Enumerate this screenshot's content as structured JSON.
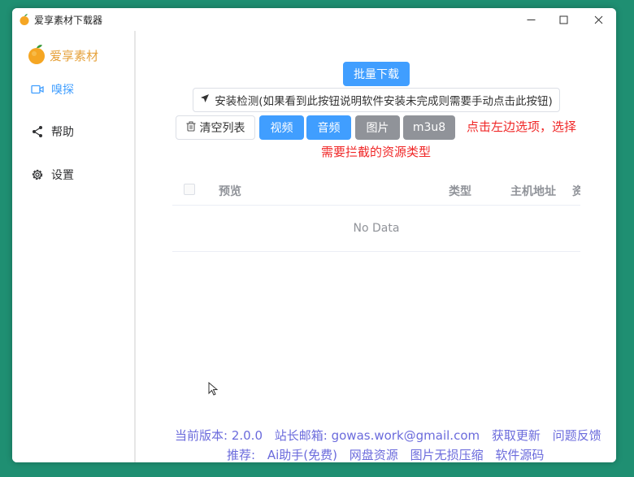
{
  "window": {
    "title": "爱享素材下载器"
  },
  "sidebar": {
    "logo_text": "爱享素材",
    "items": [
      {
        "label": "嗅探",
        "icon": "video-camera-icon"
      },
      {
        "label": "帮助",
        "icon": "share-icon"
      },
      {
        "label": "设置",
        "icon": "gear-icon"
      }
    ]
  },
  "toolbar": {
    "batch_download": "批量下载",
    "install_check": "安装检测(如果看到此按钮说明软件安装未完成则需要手动点击此按钮)",
    "clear_list": "清空列表",
    "filters": [
      "视频",
      "音频",
      "图片",
      "m3u8"
    ]
  },
  "hint": {
    "line1": "点击左边选项，选择",
    "line2": "需要拦截的资源类型"
  },
  "table": {
    "columns": [
      "预览",
      "类型",
      "主机地址",
      "资"
    ],
    "empty_text": "No Data"
  },
  "footer": {
    "version": "当前版本: 2.0.0",
    "email": "站长邮箱: gowas.work@gmail.com",
    "update": "获取更新",
    "feedback": "问题反馈",
    "recommend": "推荐:",
    "links": [
      "Ai助手(免费)",
      "网盘资源",
      "图片无损压缩",
      "软件源码"
    ]
  },
  "colors": {
    "primary": "#409eff",
    "info": "#909399",
    "danger": "#f02828",
    "footer_link": "#6b6bdc",
    "logo_text": "#e6a23c"
  }
}
